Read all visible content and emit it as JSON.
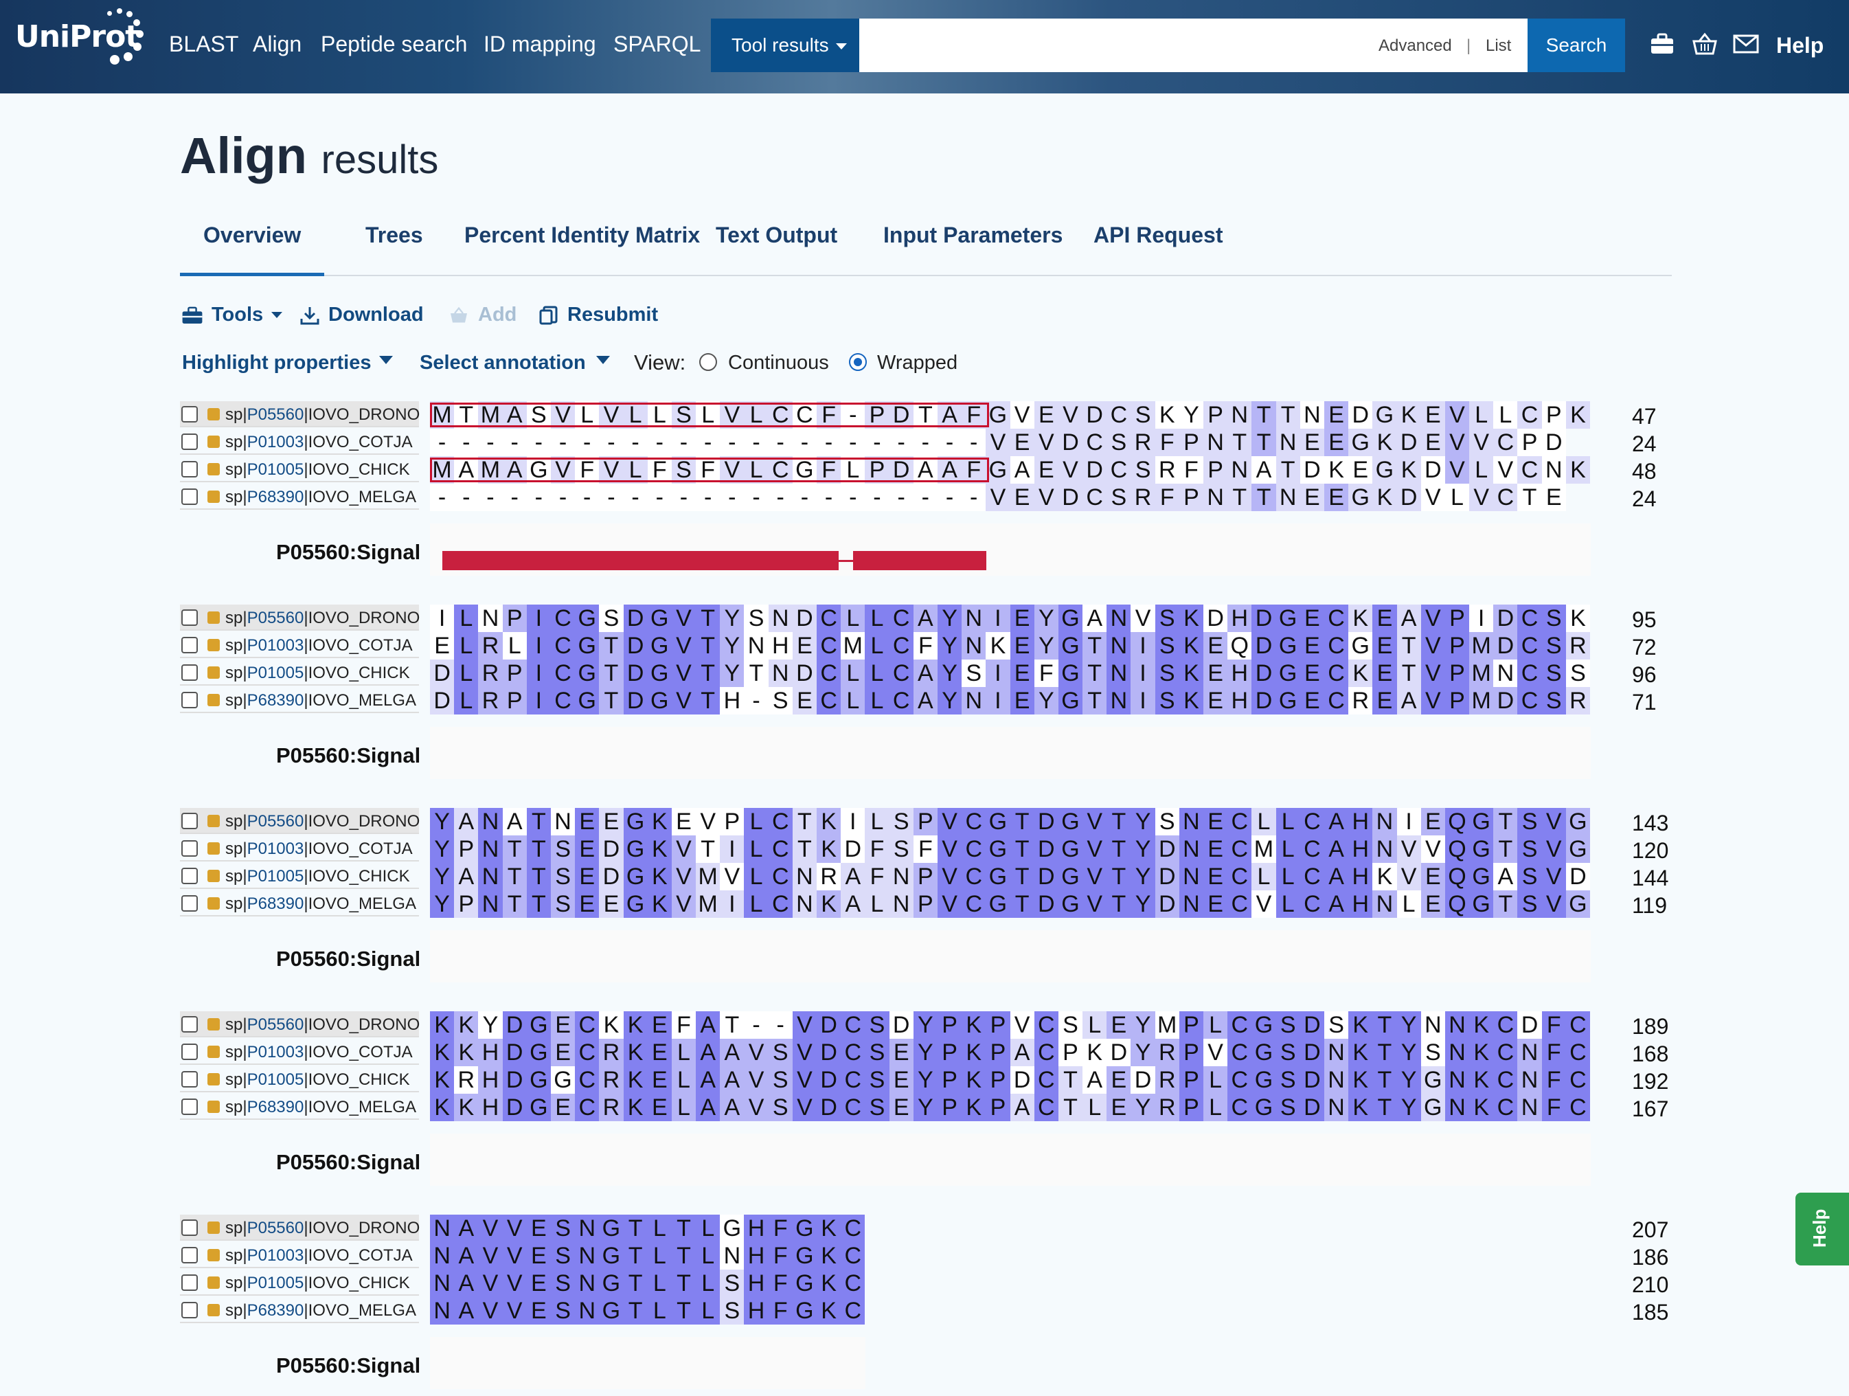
{
  "header": {
    "logo": "UniProt",
    "nav": [
      "BLAST",
      "Align",
      "Peptide search",
      "ID mapping",
      "SPARQL"
    ],
    "tool_results": "Tool results",
    "search_placeholder": "",
    "advanced": "Advanced",
    "list": "List",
    "search": "Search",
    "help": "Help"
  },
  "page": {
    "title": "Align",
    "title_sub": "results"
  },
  "tabs": [
    "Overview",
    "Trees",
    "Percent Identity Matrix",
    "Text Output",
    "Input Parameters",
    "API Request"
  ],
  "toolbar": {
    "tools": "Tools",
    "download": "Download",
    "add": "Add",
    "resubmit": "Resubmit"
  },
  "controls": {
    "highlight": "Highlight properties",
    "annotation": "Select annotation",
    "view_label": "View:",
    "continuous": "Continuous",
    "wrapped": "Wrapped",
    "selected_view": "Wrapped"
  },
  "sequences": [
    {
      "db": "sp",
      "accession": "P05560",
      "entry": "IOVO_DRONO"
    },
    {
      "db": "sp",
      "accession": "P01003",
      "entry": "IOVO_COTJA"
    },
    {
      "db": "sp",
      "accession": "P01005",
      "entry": "IOVO_CHICK"
    },
    {
      "db": "sp",
      "accession": "P68390",
      "entry": "IOVO_MELGA"
    }
  ],
  "signal_label": "P05560:Signal",
  "blocks": [
    {
      "seqs": [
        "MTMASVLVLLSLVLCCF-PDTAFGVEVDCSKYPNTTNEDGKEVLLCPK",
        "-----------------------VEVDCSRFPNTTNEEGKDEVVCPD",
        "MAMAGVFVLFSFVLCGFLPDAAFGAEVDCSRFPNATDKEGKDVLVCNK",
        "-----------------------VEVDCSRFPNTTNEEGKDVLVCTE"
      ],
      "ends": [
        47,
        24,
        48,
        24
      ]
    },
    {
      "seqs": [
        "ILNPICGSDGVTYSNDCLLCAYNIEYGANVSKDHDGECKEAVPIDCSK",
        "ELRLICGTDGVTYNHECMLCFYNKEYGTNISKEQDGECGETVPMDCSR",
        "DLRPICGTDGVTYTNDCLLCAYSIEFGTNISKEHDGECKETVPMNCSS",
        "DLRPICGTDGVTH-SECLLCAYNIEYGTNISKEHDGECREAVPMDCSR"
      ],
      "ends": [
        95,
        72,
        96,
        71
      ]
    },
    {
      "seqs": [
        "YANATNEEGKEVPLCTKILSPVCGTDGVTYSNECLLCAHNIEQGTSVG",
        "YPNTTSEDGKVTILCTKDFSFVCGTDGVTYDNECMLCAHNVVQGTSVG",
        "YANTTSEDGKVMVLCNRAFNPVCGTDGVTYDNECLLCAHKVEQGASVD",
        "YPNTTSEEGKVMILCNKALNPVCGTDGVTYDNECVLCAHNLEQGTSVG"
      ],
      "ends": [
        143,
        120,
        144,
        119
      ]
    },
    {
      "seqs": [
        "KKYDGECKKEFAT--VDCSDYPKPVCSLEYMPLCGSDSKTYNNKCDFC",
        "KKHDGECRKELAAVSVDCSEYPKPACPKDYRPVCGSDNKTYSNKCNFC",
        "KRHDGGCRKELAAVSVDCSEYPKPDCTAEDRPLCGSDNKTYGNKCNFC",
        "KKHDGECRKELAAVSVDCSEYPKPACTLEYRPLCGSDNKTYGNKCNFC"
      ],
      "ends": [
        189,
        168,
        192,
        167
      ]
    },
    {
      "seqs": [
        "NAVVESNGTLTLGHFGKC",
        "NAVVESNGTLTLNHFGKC",
        "NAVVESNGTLTLSHFGKC",
        "NAVVESNGTLTLSHFGKC"
      ],
      "ends": [
        207,
        186,
        210,
        185
      ]
    }
  ],
  "help_tab": "Help"
}
